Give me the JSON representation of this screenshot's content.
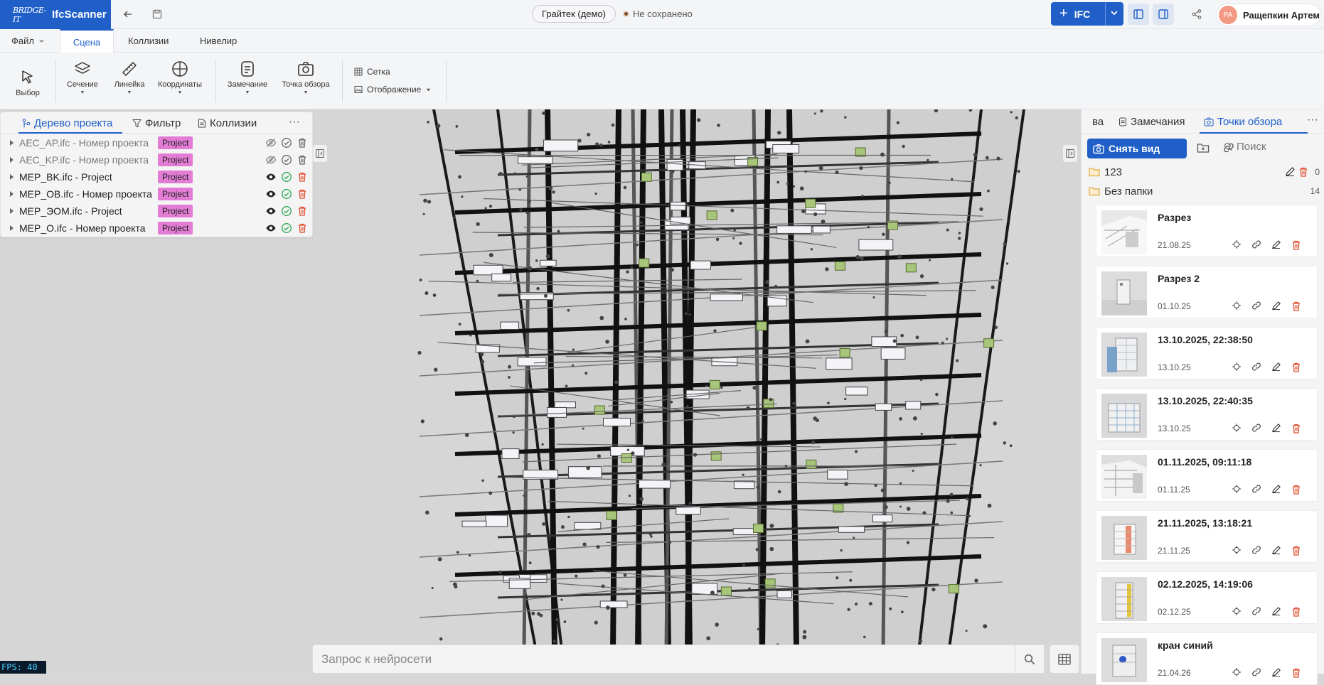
{
  "app": {
    "logo_mark": "BRIDGE-IT",
    "name": "IfcScanner"
  },
  "topbar": {
    "project_name": "Грайтек (демо)",
    "save_status": "Не сохранено",
    "ifc_button": "IFC",
    "user_initials": "РА",
    "user_name": "Ращепкин Артем"
  },
  "menu": {
    "file": "Файл",
    "tabs": [
      "Сцена",
      "Коллизии",
      "Нивелир"
    ],
    "active_tab": "Сцена"
  },
  "ribbon": {
    "select": "Выбор",
    "section": "Сечение",
    "ruler": "Линейка",
    "coordinates": "Координаты",
    "remark": "Замечание",
    "viewpoint": "Точка обзора",
    "grid": "Сетка",
    "display": "Отображение"
  },
  "left_panel": {
    "tabs": [
      "Дерево проекта",
      "Фильтр",
      "Коллизии"
    ],
    "rows": [
      {
        "name": "AEC_AP.ifc - Номер проекта",
        "badge": "Project",
        "visible": false
      },
      {
        "name": "AEC_KP.ifc - Номер проекта",
        "badge": "Project",
        "visible": false
      },
      {
        "name": "MEP_BK.ifc - Project",
        "badge": "Project",
        "visible": true
      },
      {
        "name": "MEP_OB.ifc - Номер проекта",
        "badge": "Project",
        "visible": true
      },
      {
        "name": "MEP_ЭОМ.ifc - Project",
        "badge": "Project",
        "visible": true
      },
      {
        "name": "MEP_O.ifc - Номер проекта",
        "badge": "Project",
        "visible": true
      }
    ]
  },
  "viewport": {
    "fps": "FPS: 40"
  },
  "ai_search": {
    "placeholder": "Запрос к нейросети"
  },
  "right_panel": {
    "tabs": [
      "ва",
      "Замечания",
      "Точки обзора"
    ],
    "snap_button": "Снять вид",
    "search_placeholder": "Поиск",
    "folders": [
      {
        "name": "123",
        "count": "0"
      },
      {
        "name": "Без папки",
        "count": "14"
      }
    ],
    "views": [
      {
        "title": "Разрез",
        "date": "21.08.25"
      },
      {
        "title": "Разрез 2",
        "date": "01.10.25"
      },
      {
        "title": "13.10.2025, 22:38:50",
        "date": "13.10.25"
      },
      {
        "title": "13.10.2025, 22:40:35",
        "date": "13.10.25"
      },
      {
        "title": "01.11.2025, 09:11:18",
        "date": "01.11.25"
      },
      {
        "title": "21.11.2025, 13:18:21",
        "date": "21.11.25"
      },
      {
        "title": "02.12.2025, 14:19:06",
        "date": "02.12.25"
      },
      {
        "title": "кран синий",
        "date": "21.04.26"
      }
    ]
  },
  "colors": {
    "accent": "#1f5fc7",
    "badge": "#e27cd5",
    "danger": "#e04b2b",
    "ok": "#2aa852"
  }
}
